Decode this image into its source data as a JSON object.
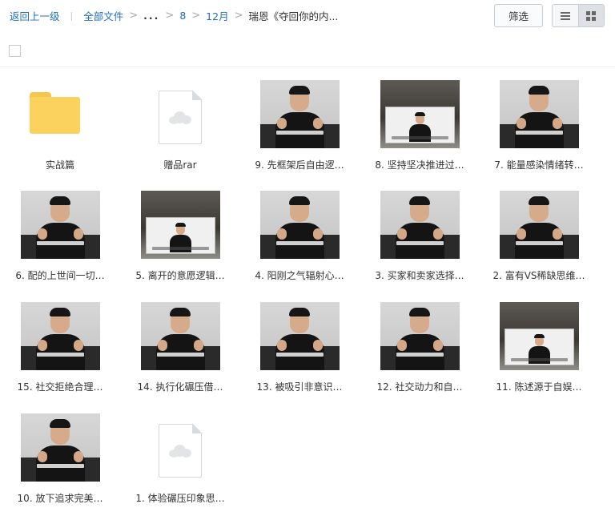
{
  "breadcrumb": {
    "back": "返回上一级",
    "separator": "|",
    "root": "全部文件",
    "arrow": ">",
    "ellipsis": "...",
    "level_1": "8",
    "level_2": "12月",
    "current": "瑞恩《夺回你的内..."
  },
  "toolbar": {
    "filter_label": "筛选",
    "view_modes": [
      "list",
      "grid"
    ],
    "active_view": "grid"
  },
  "items": [
    {
      "name": "实战篇",
      "kind": "folder"
    },
    {
      "name": "赠品rar",
      "kind": "file"
    },
    {
      "name": "9. 先框架后自由逻…",
      "kind": "video"
    },
    {
      "name": "8. 坚持坚决推进过…",
      "kind": "video-screen"
    },
    {
      "name": "7. 能量感染情绪转…",
      "kind": "video"
    },
    {
      "name": "6. 配的上世间一切…",
      "kind": "video"
    },
    {
      "name": "5. 离开的意愿逻辑…",
      "kind": "video-screen"
    },
    {
      "name": "4. 阳刚之气辐射心…",
      "kind": "video"
    },
    {
      "name": "3. 买家和卖家选择…",
      "kind": "video"
    },
    {
      "name": "2. 富有VS稀缺思维…",
      "kind": "video"
    },
    {
      "name": "15. 社交拒绝合理…",
      "kind": "video"
    },
    {
      "name": "14. 执行化碾压借…",
      "kind": "video"
    },
    {
      "name": "13. 被吸引非意识…",
      "kind": "video"
    },
    {
      "name": "12. 社交动力和自…",
      "kind": "video"
    },
    {
      "name": "11. 陈述源于自娱…",
      "kind": "video-screen"
    },
    {
      "name": "10. 放下追求完美…",
      "kind": "video"
    },
    {
      "name": "1. 体验碾压印象思…",
      "kind": "file"
    }
  ],
  "colors": {
    "link": "#1f6fbf",
    "folder": "#fcd25f",
    "folder_tab": "#f6c649"
  }
}
